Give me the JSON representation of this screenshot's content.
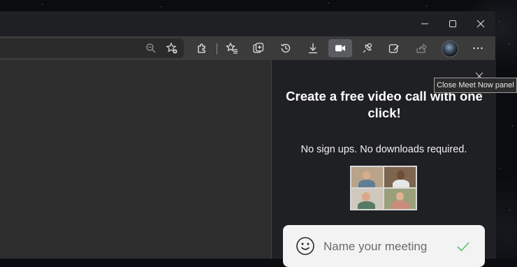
{
  "window": {
    "controls": {
      "minimize_icon": "minimize-icon",
      "maximize_icon": "maximize-icon",
      "close_icon": "close-icon"
    }
  },
  "toolbar": {
    "icons": [
      "zoom-icon",
      "add-favorite-icon",
      "extensions-icon",
      "favorites-icon",
      "collections-icon",
      "history-icon",
      "downloads-icon",
      "meet-now-icon",
      "performance-icon",
      "web-capture-icon",
      "share-icon",
      "profile-avatar",
      "more-icon"
    ]
  },
  "meet_now_panel": {
    "close_tooltip": "Close Meet Now panel",
    "headline": "Create a free video call with one click!",
    "subline": "No sign ups. No downloads required.",
    "meeting_name_placeholder": "Name your meeting",
    "meeting_name_value": ""
  },
  "colors": {
    "titlebar": "#1f2023",
    "toolbar": "#3b3b3b",
    "panel_background": "#1f2023",
    "content_background": "#2d2d2d",
    "meeting_box": "#f3f3f3",
    "check_green": "#4caf50",
    "active_icon_background": "#5a5c60"
  }
}
